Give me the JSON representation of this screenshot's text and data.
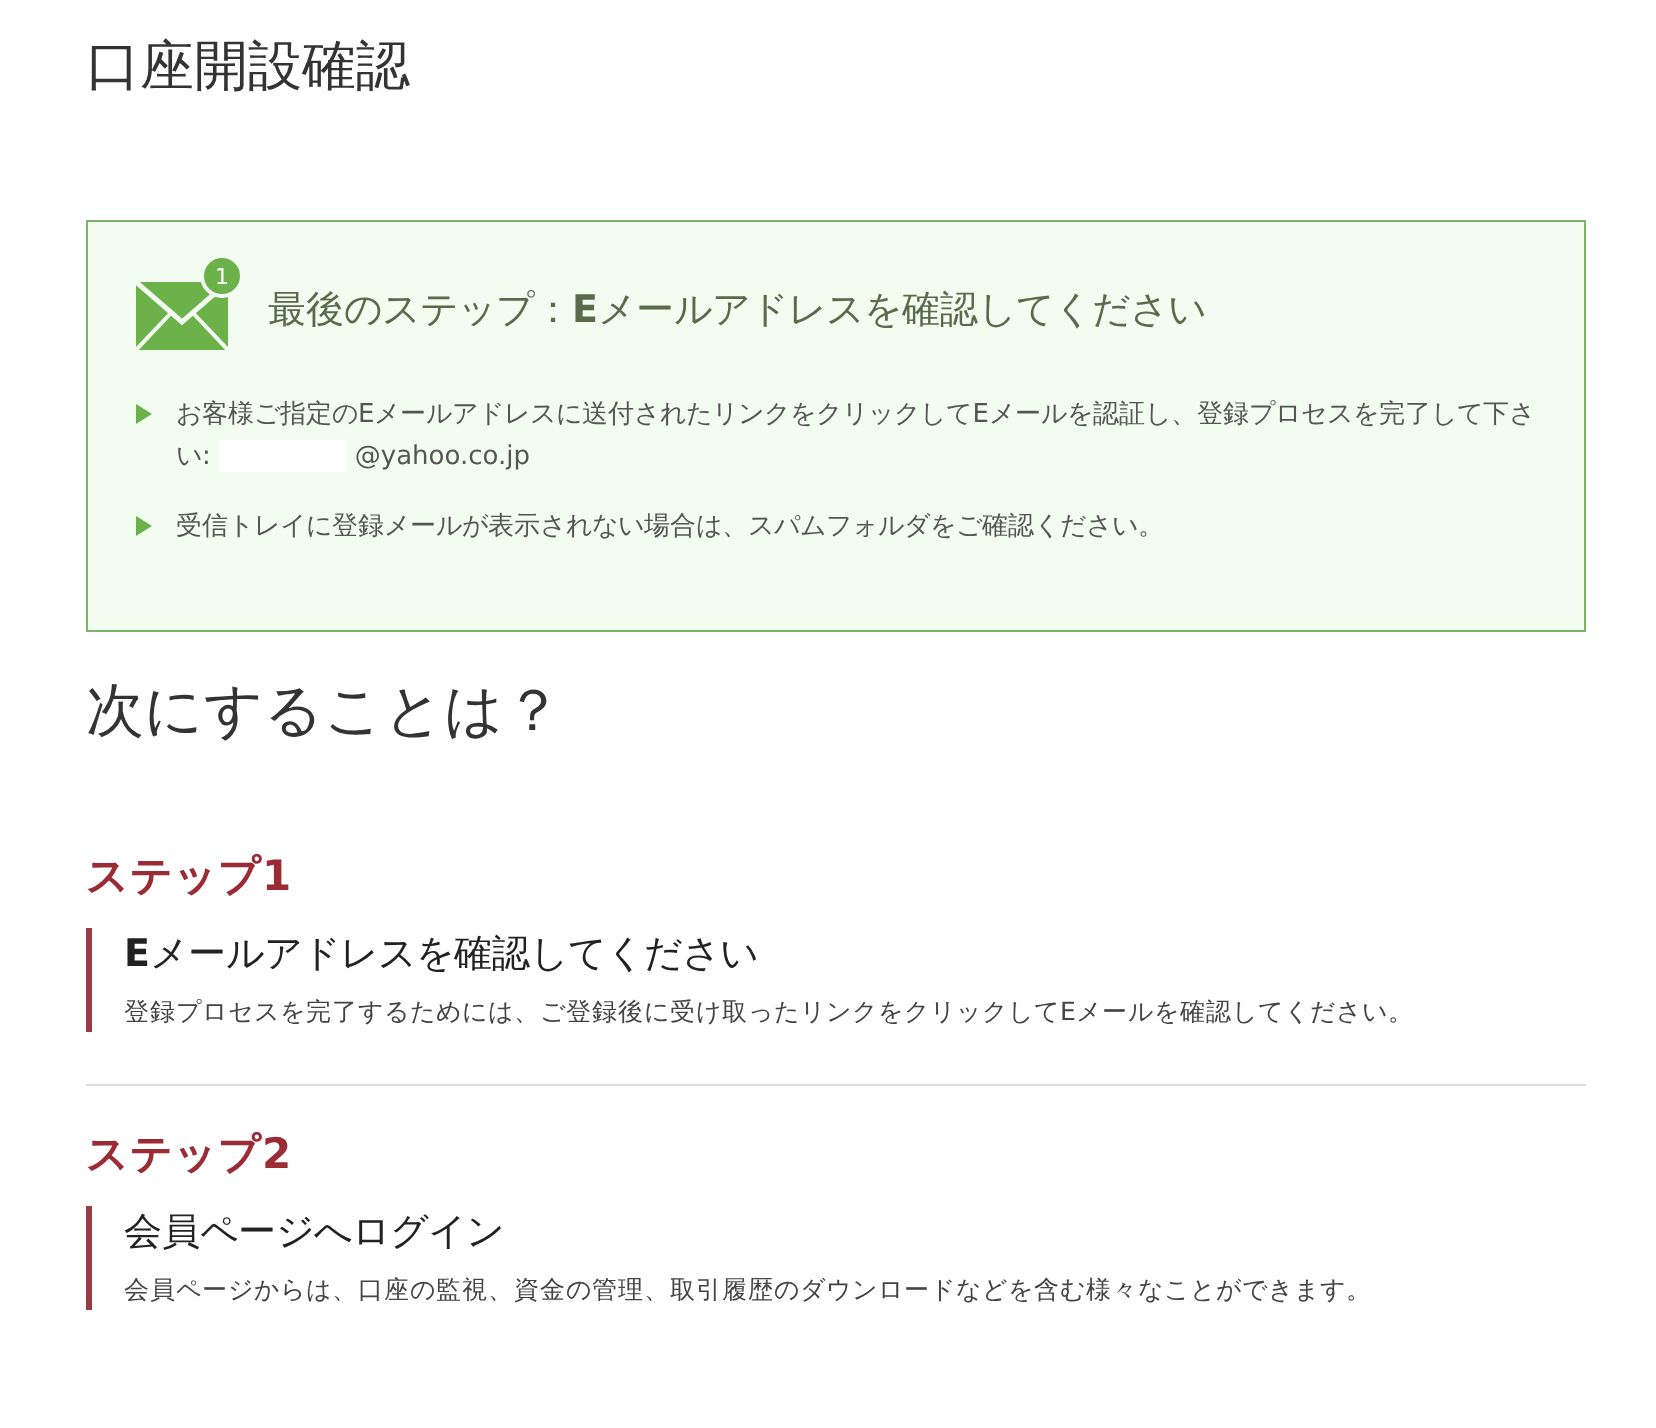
{
  "page_title": "口座開設確認",
  "notice": {
    "badge": "1",
    "title": "最後のステップ：**E**メールアドレスを確認してください",
    "items": [
      {
        "text": "お客様ご指定のEメールアドレスに送付されたリンクをクリックしてEメールを認証し、登録プロセスを完了して下さい:",
        "email": "@yahoo.co.jp"
      },
      {
        "text": "受信トレイに登録メールが表示されない場合は、スパムフォルダをご確認ください。"
      }
    ]
  },
  "next_heading": "次にすることは？",
  "steps": [
    {
      "label": "ステップ1",
      "title": "**E**メールアドレスを確認してください",
      "description": "登録プロセスを完了するためには、ご登録後に受け取ったリンクをクリックしてEメールを確認してください。"
    },
    {
      "label": "ステップ2",
      "title": "会員ページへログイン",
      "description": "会員ページからは、口座の監視、資金の管理、取引履歴のダウンロードなどを含む様々なことができます。"
    }
  ]
}
